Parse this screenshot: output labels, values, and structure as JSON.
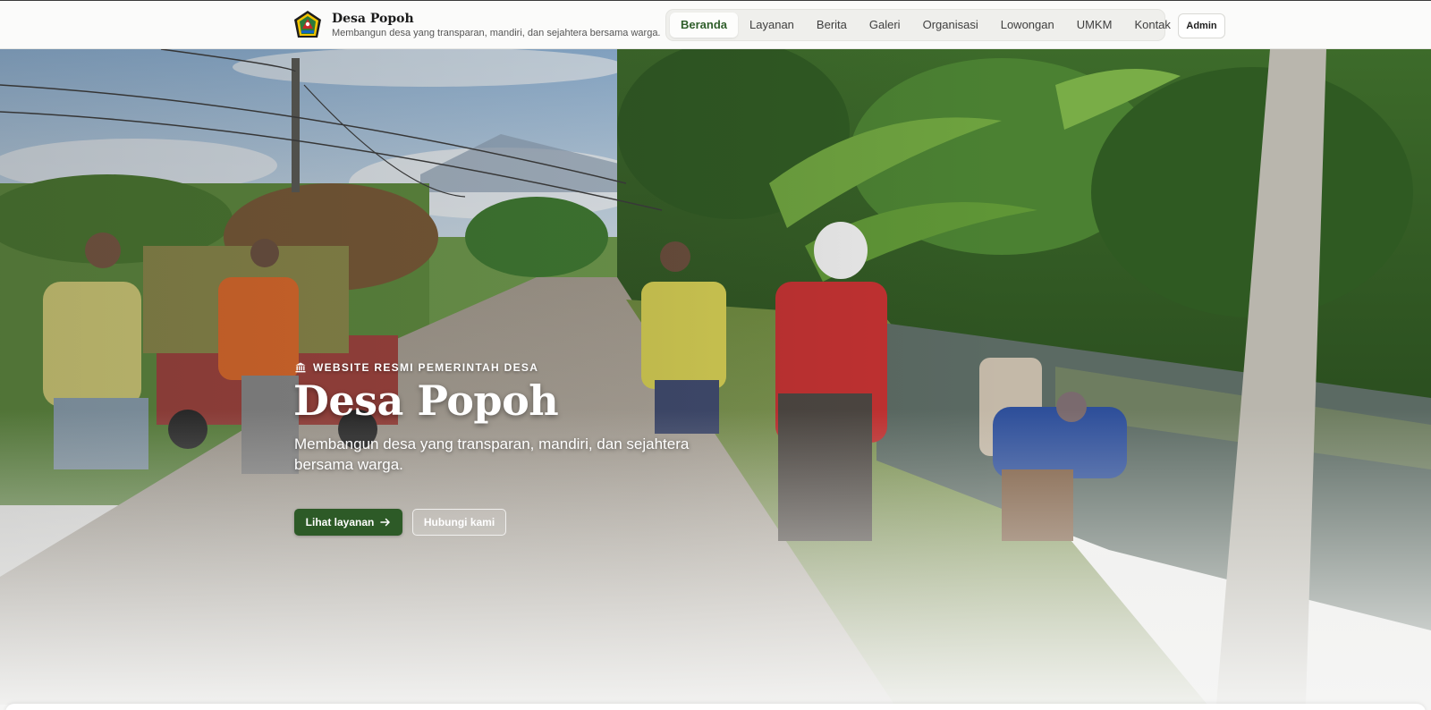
{
  "site": {
    "name": "Desa Popoh",
    "tagline": "Membangun desa yang transparan, mandiri, dan sejahtera bersama warga.",
    "logo_icon": "village-emblem-icon"
  },
  "nav": {
    "items": [
      {
        "label": "Beranda",
        "active": true
      },
      {
        "label": "Layanan",
        "active": false
      },
      {
        "label": "Berita",
        "active": false
      },
      {
        "label": "Galeri",
        "active": false
      },
      {
        "label": "Organisasi",
        "active": false
      },
      {
        "label": "Lowongan",
        "active": false
      },
      {
        "label": "UMKM",
        "active": false
      },
      {
        "label": "Kontak",
        "active": false
      }
    ],
    "admin_label": "Admin"
  },
  "hero": {
    "eyebrow": "WEBSITE RESMI PEMERINTAH DESA",
    "eyebrow_icon": "government-building-icon",
    "title": "Desa Popoh",
    "subtitle": "Membangun desa yang transparan, mandiri, dan sejahtera bersama warga.",
    "primary_cta": "Lihat layanan",
    "primary_cta_icon": "arrow-right-icon",
    "secondary_cta": "Hubungi kami",
    "image_description_icon": "hero-photo"
  },
  "colors": {
    "brand_green": "#2d5a27",
    "nav_active_text": "#2f5e2b"
  }
}
